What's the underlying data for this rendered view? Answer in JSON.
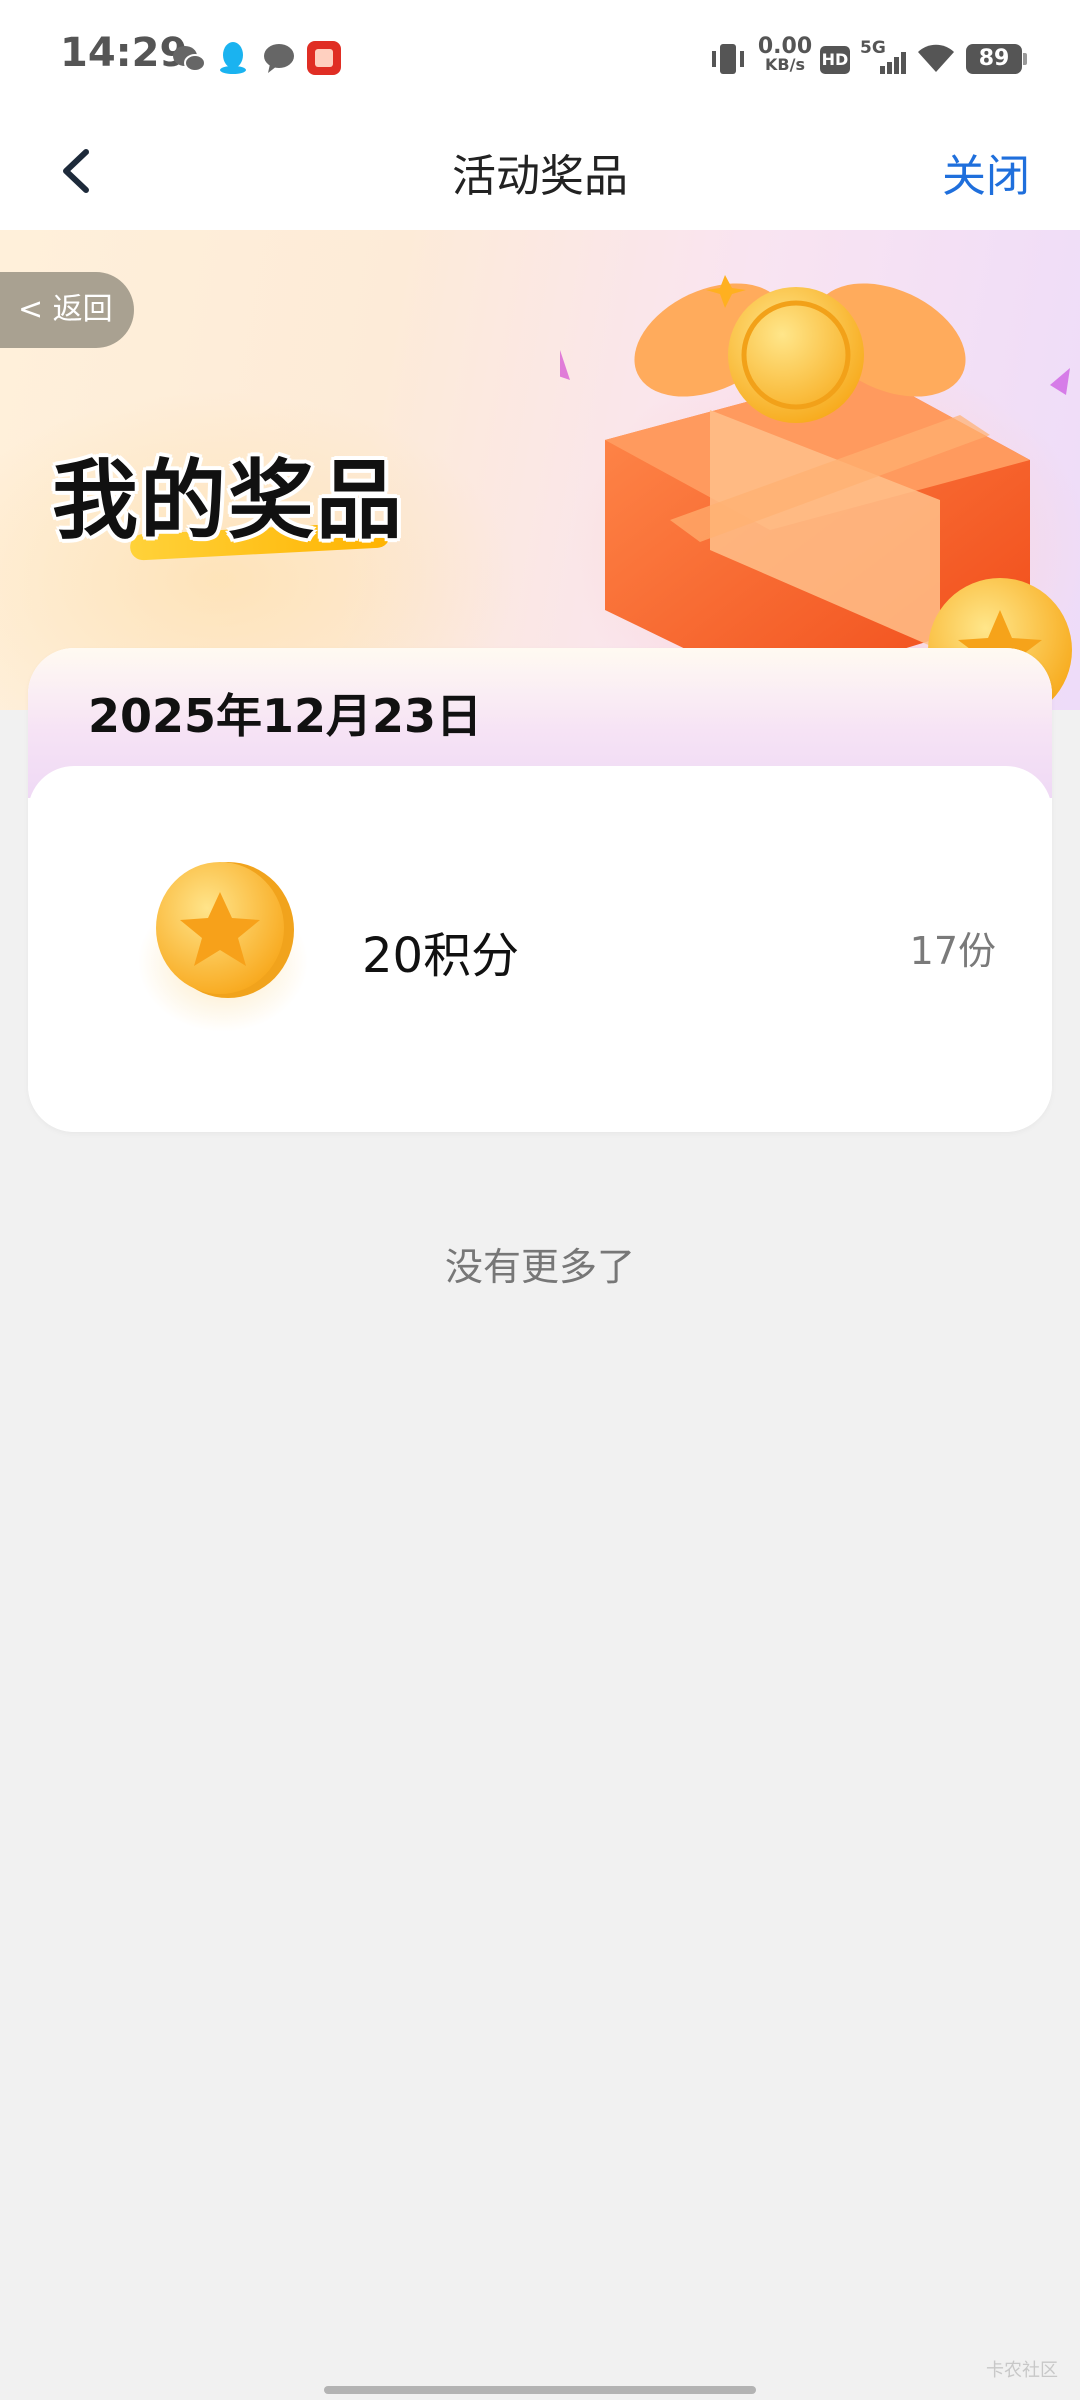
{
  "status_bar": {
    "time": "14:29",
    "net_speed_value": "0.00",
    "net_speed_unit": "KB/s",
    "hd_label": "HD",
    "network_label": "5G",
    "battery": "89",
    "notification_icons": [
      "wechat-icon",
      "qq-icon",
      "message-icon",
      "pinduoduo-icon"
    ],
    "system_icons": [
      "vibrate-icon",
      "hd-icon",
      "signal-5g-icon",
      "wifi-icon",
      "battery-icon"
    ]
  },
  "nav": {
    "title": "活动奖品",
    "close_label": "关闭",
    "back_icon": "chevron-left-icon"
  },
  "banner": {
    "back_label": "< 返回",
    "title": "我的奖品"
  },
  "prize_card": {
    "date": "2025年12月23日",
    "items": [
      {
        "icon": "coin-star-icon",
        "name": "20积分",
        "quantity": "17份"
      }
    ]
  },
  "footer": {
    "no_more_text": "没有更多了"
  },
  "watermark": "卡农社区",
  "colors": {
    "accent_blue": "#1f6fdc",
    "page_bg": "#f1f1f1",
    "gift_orange": "#ff6a2b",
    "coin_gold": "#ffc53d"
  }
}
